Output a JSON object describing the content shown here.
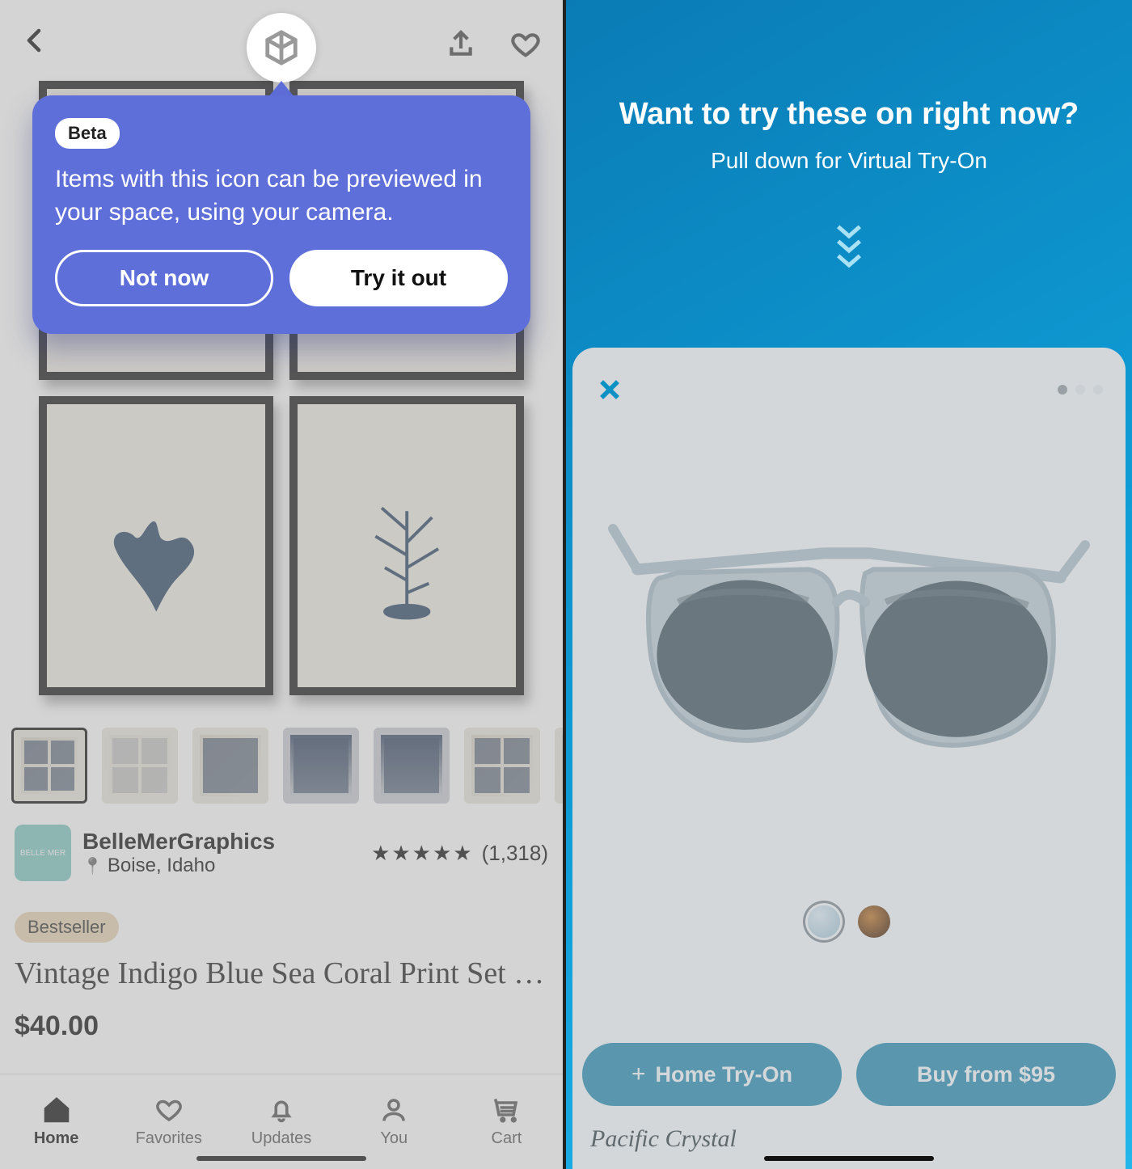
{
  "left": {
    "tooltip": {
      "badge": "Beta",
      "text": "Items with this icon can be previewed in your space, using your camera.",
      "not_now": "Not now",
      "try_it": "Try it out"
    },
    "seller": {
      "name": "BelleMerGraphics",
      "location": "Boise, Idaho"
    },
    "rating": {
      "stars": "★★★★★",
      "count": "(1,318)"
    },
    "bestseller": "Bestseller",
    "title": "Vintage Indigo Blue Sea Coral Print Set N…",
    "price": "$40.00",
    "tabs": {
      "home": "Home",
      "favorites": "Favorites",
      "updates": "Updates",
      "you": "You",
      "cart": "Cart"
    }
  },
  "right": {
    "hero_title": "Want to try these on right now?",
    "hero_sub": "Pull down for Virtual Try-On",
    "home_tryon": "Home Try-On",
    "buy": "Buy from $95",
    "product_name": "Pacific Crystal"
  }
}
